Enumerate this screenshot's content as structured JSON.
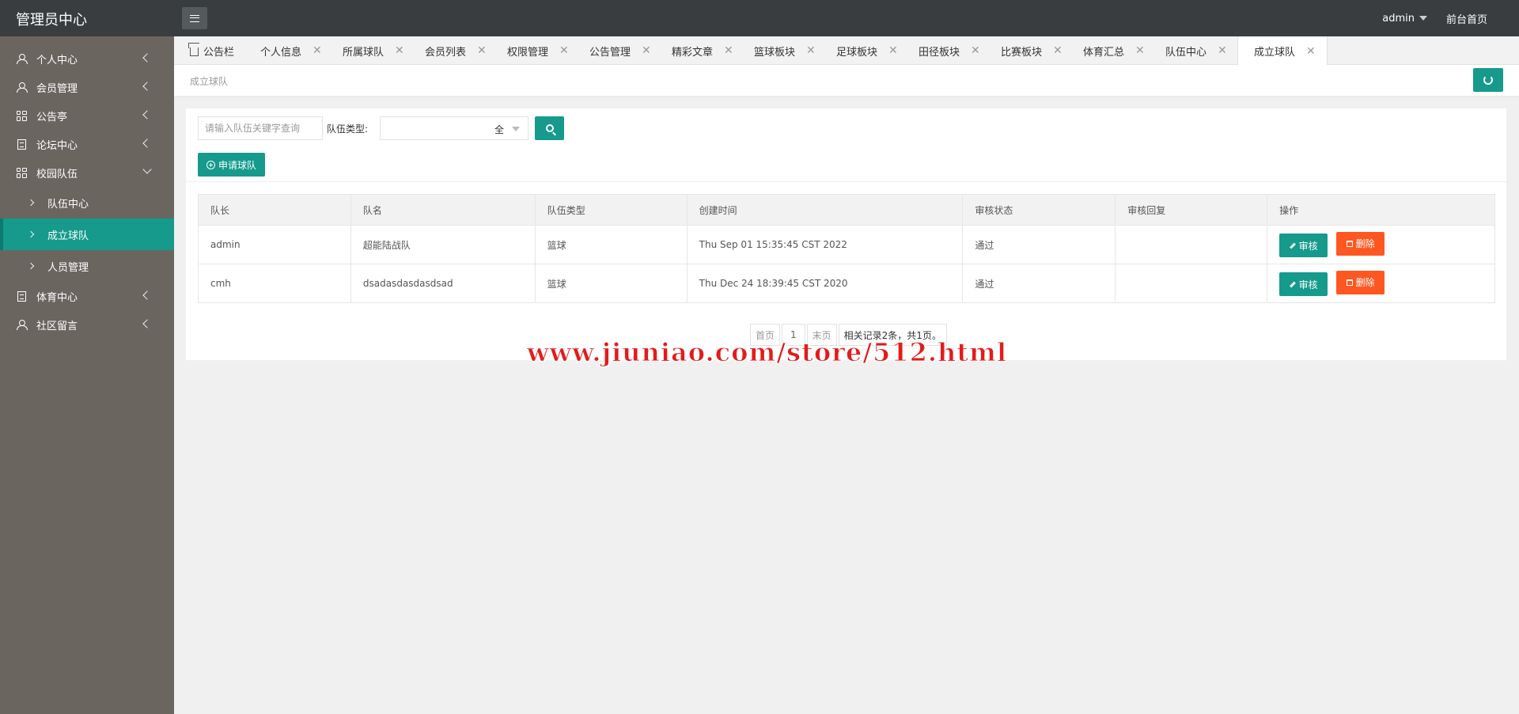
{
  "header": {
    "title": "管理员中心",
    "user": "admin",
    "frontend_link": "前台首页"
  },
  "sidebar": {
    "items": [
      {
        "label": "个人中心",
        "icon": "user-icon"
      },
      {
        "label": "会员管理",
        "icon": "user-icon"
      },
      {
        "label": "公告亭",
        "icon": "grid-icon"
      },
      {
        "label": "论坛中心",
        "icon": "doc-icon"
      },
      {
        "label": "校园队伍",
        "icon": "grid-icon",
        "expanded": true,
        "children": [
          {
            "label": "队伍中心"
          },
          {
            "label": "成立球队",
            "active": true
          },
          {
            "label": "人员管理"
          }
        ]
      },
      {
        "label": "体育中心",
        "icon": "doc-icon"
      },
      {
        "label": "社区留言",
        "icon": "user-icon"
      }
    ]
  },
  "tabs": [
    {
      "label": "公告栏"
    },
    {
      "label": "个人信息"
    },
    {
      "label": "所属球队"
    },
    {
      "label": "会员列表"
    },
    {
      "label": "权限管理"
    },
    {
      "label": "公告管理"
    },
    {
      "label": "精彩文章"
    },
    {
      "label": "篮球板块"
    },
    {
      "label": "足球板块"
    },
    {
      "label": "田径板块"
    },
    {
      "label": "比赛板块"
    },
    {
      "label": "体育汇总"
    },
    {
      "label": "队伍中心"
    },
    {
      "label": "成立球队",
      "active": true
    }
  ],
  "breadcrumb": "成立球队",
  "search": {
    "placeholder": "请输入队伍关键字查询",
    "type_label": "队伍类型:",
    "type_value": "全"
  },
  "apply_button": "申请球队",
  "table": {
    "columns": [
      "队长",
      "队名",
      "队伍类型",
      "创建时间",
      "审核状态",
      "审核回复",
      "操作"
    ],
    "rows": [
      [
        "admin",
        "超能陆战队",
        "篮球",
        "Thu Sep 01 15:35:45 CST 2022",
        "通过",
        ""
      ],
      [
        "cmh",
        "dsadasdasdasdsad",
        "篮球",
        "Thu Dec 24 18:39:45 CST 2020",
        "通过",
        ""
      ]
    ],
    "edit_label": "审核",
    "delete_label": "删除"
  },
  "pager": {
    "first": "首页",
    "current": "1",
    "last": "末页",
    "info": "相关记录2条，共1页。"
  },
  "watermark": "www.jiuniao.com/store/512.html",
  "colors": {
    "accent": "#159a8c",
    "danger": "#ff5722",
    "header": "#393d3f",
    "sidebar": "#6b6560"
  }
}
